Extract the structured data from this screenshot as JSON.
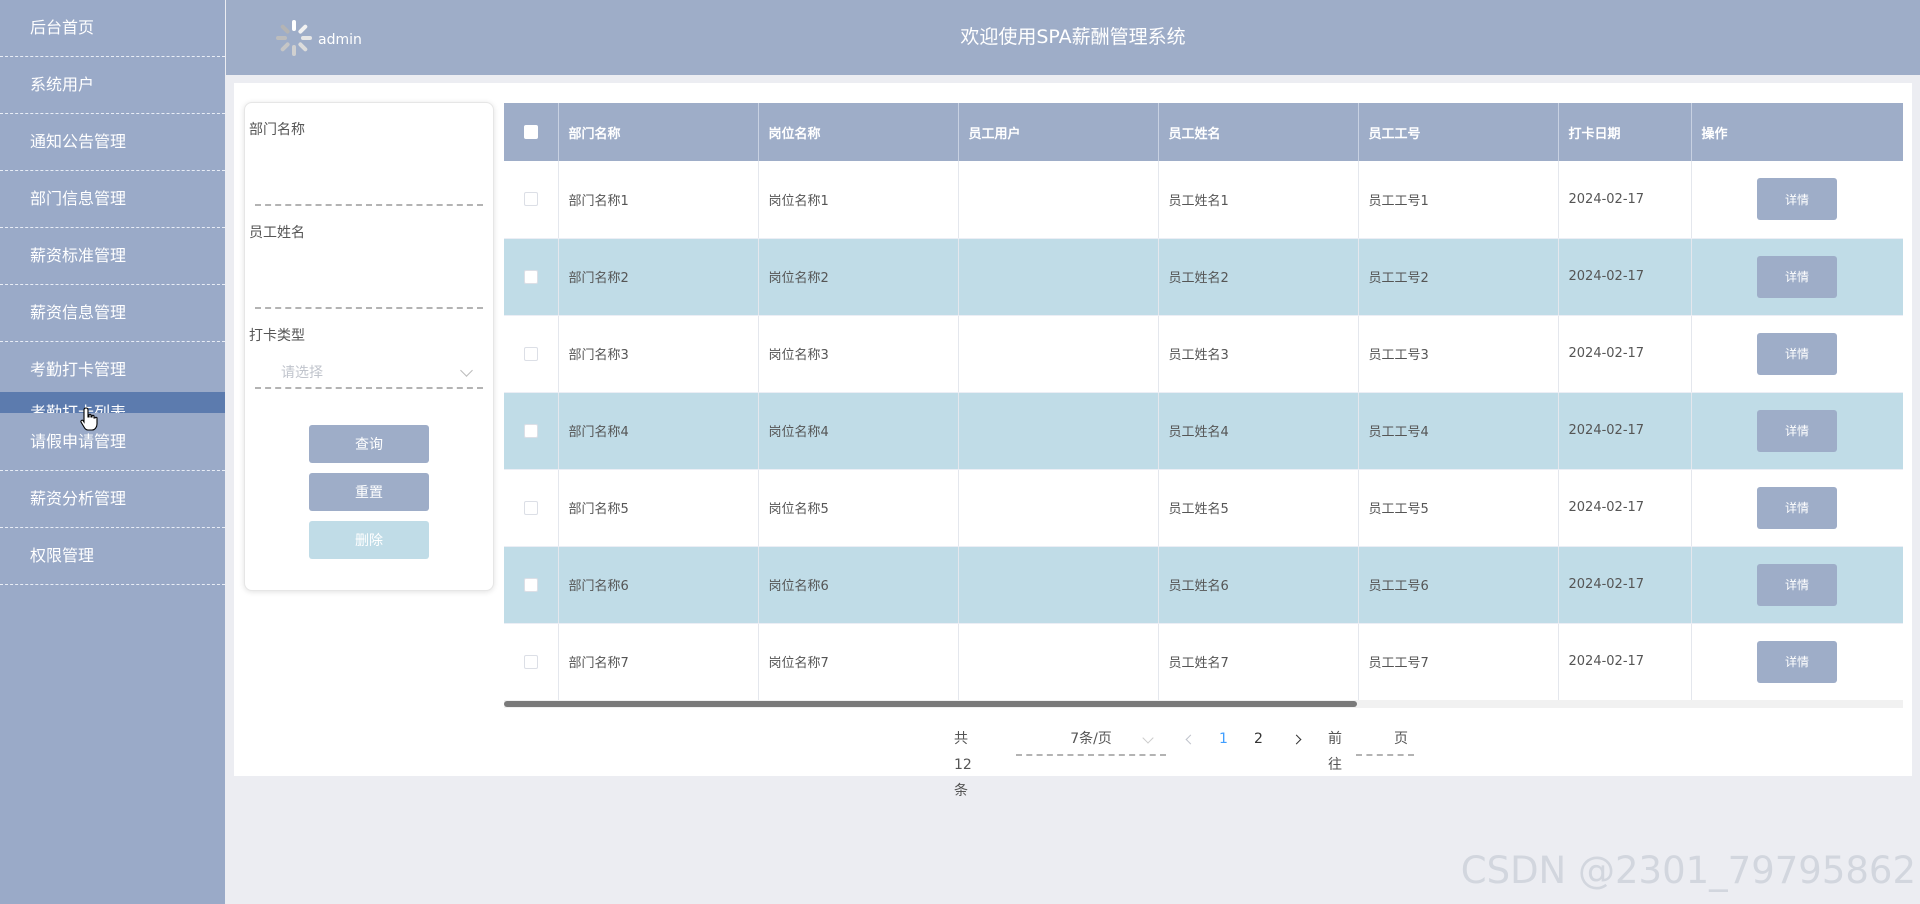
{
  "sidebar": {
    "items": [
      {
        "label": "后台首页"
      },
      {
        "label": "系统用户"
      },
      {
        "label": "通知公告管理"
      },
      {
        "label": "部门信息管理"
      },
      {
        "label": "薪资标准管理"
      },
      {
        "label": "薪资信息管理"
      },
      {
        "label": "考勤打卡管理"
      },
      {
        "label": "考勤打卡列表"
      },
      {
        "label": "请假申请管理"
      },
      {
        "label": "薪资分析管理"
      },
      {
        "label": "权限管理"
      }
    ]
  },
  "header": {
    "username": "admin",
    "title": "欢迎使用SPA薪酬管理系统"
  },
  "filter": {
    "dept_label": "部门名称",
    "dept_value": "",
    "name_label": "员工姓名",
    "name_value": "",
    "type_label": "打卡类型",
    "type_placeholder": "请选择",
    "query_btn": "查询",
    "reset_btn": "重置",
    "delete_btn": "删除"
  },
  "table": {
    "columns": [
      "部门名称",
      "岗位名称",
      "员工用户",
      "员工姓名",
      "员工工号",
      "打卡日期",
      "操作"
    ],
    "detail_btn": "详情",
    "rows": [
      {
        "dept": "部门名称1",
        "post": "岗位名称1",
        "user": "",
        "name": "员工姓名1",
        "no": "员工工号1",
        "date": "2024-02-17"
      },
      {
        "dept": "部门名称2",
        "post": "岗位名称2",
        "user": "",
        "name": "员工姓名2",
        "no": "员工工号2",
        "date": "2024-02-17"
      },
      {
        "dept": "部门名称3",
        "post": "岗位名称3",
        "user": "",
        "name": "员工姓名3",
        "no": "员工工号3",
        "date": "2024-02-17"
      },
      {
        "dept": "部门名称4",
        "post": "岗位名称4",
        "user": "",
        "name": "员工姓名4",
        "no": "员工工号4",
        "date": "2024-02-17"
      },
      {
        "dept": "部门名称5",
        "post": "岗位名称5",
        "user": "",
        "name": "员工姓名5",
        "no": "员工工号5",
        "date": "2024-02-17"
      },
      {
        "dept": "部门名称6",
        "post": "岗位名称6",
        "user": "",
        "name": "员工姓名6",
        "no": "员工工号6",
        "date": "2024-02-17"
      },
      {
        "dept": "部门名称7",
        "post": "岗位名称7",
        "user": "",
        "name": "员工姓名7",
        "no": "员工工号7",
        "date": "2024-02-17"
      }
    ]
  },
  "pagination": {
    "total": "共 12 条",
    "page_size": "7条/页",
    "pages": [
      "1",
      "2"
    ],
    "current": "1",
    "goto_label": "前往",
    "goto_value": "",
    "goto_suffix": "页"
  },
  "watermark": "CSDN @2301_79795862",
  "icons": {
    "avatar": "loading-avatar-icon",
    "cursor": "hand-pointer-icon"
  },
  "colors": {
    "sidebar": "#9aaac8",
    "header": "#9eadc8",
    "active": "#5c7bae",
    "row_alt": "#c0dce7",
    "page_active": "#409eff"
  }
}
